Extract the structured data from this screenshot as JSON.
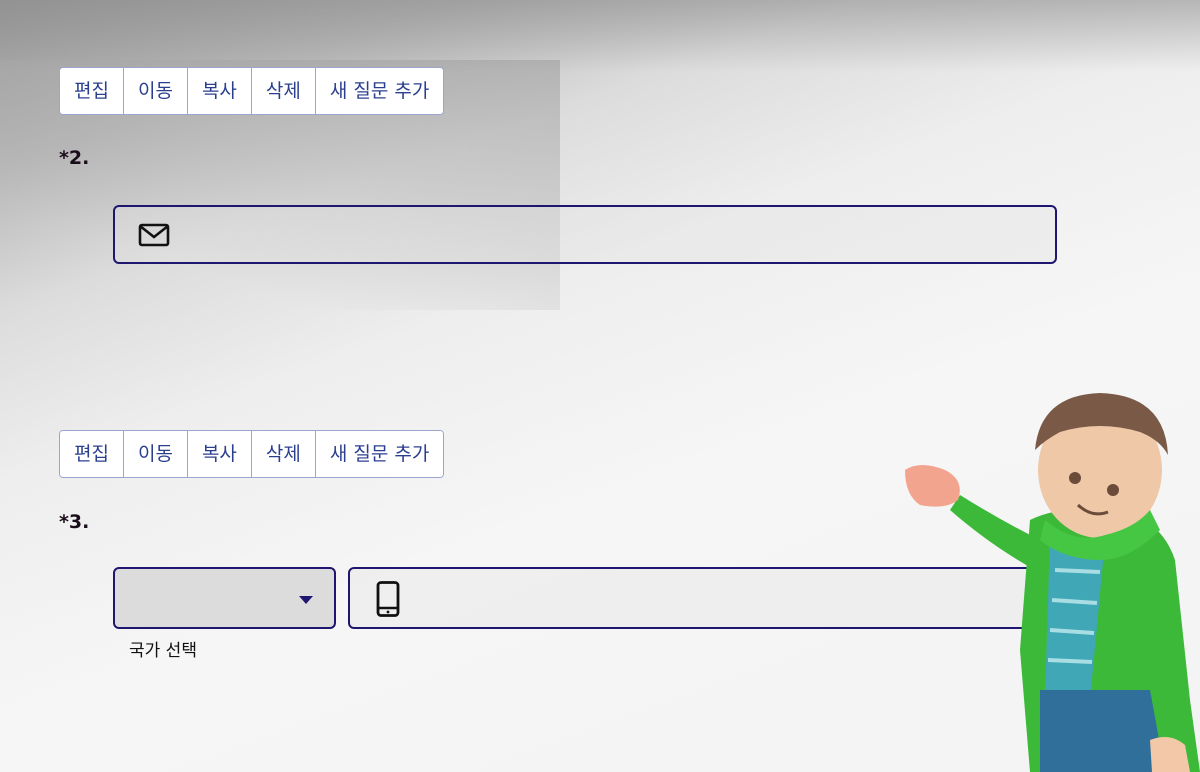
{
  "toolbar_labels": {
    "edit": "편집",
    "move": "이동",
    "copy": "복사",
    "delete": "삭제",
    "add_question": "새 질문 추가"
  },
  "questions": [
    {
      "number": "*2.",
      "input_icon": "mail-icon",
      "value": ""
    },
    {
      "number": "*3.",
      "input_icon": "phone-icon",
      "country_select_value": "",
      "country_label": "국가 선택",
      "value": ""
    }
  ],
  "colors": {
    "accent": "#1f1670",
    "button_text": "#2b3f8f",
    "button_border": "#9aa6cf"
  }
}
